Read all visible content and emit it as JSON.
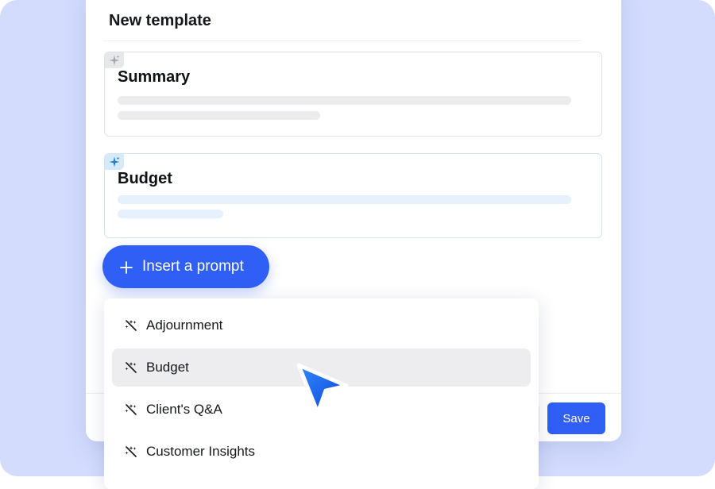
{
  "template": {
    "title": "New template",
    "blocks": [
      {
        "title": "Summary",
        "icon": "sparkle-icon",
        "state": "inactive"
      },
      {
        "title": "Budget",
        "icon": "sparkle-icon",
        "state": "active"
      }
    ]
  },
  "insert_button": {
    "label": "Insert a prompt",
    "icon": "plus-icon"
  },
  "footer": {
    "save_label": "Save"
  },
  "prompt_menu": {
    "selected_index": 1,
    "items": [
      {
        "label": "Adjournment",
        "icon": "magic-wand-icon"
      },
      {
        "label": "Budget",
        "icon": "magic-wand-icon"
      },
      {
        "label": "Client's Q&A",
        "icon": "magic-wand-icon"
      },
      {
        "label": "Customer Insights",
        "icon": "magic-wand-icon"
      }
    ]
  },
  "colors": {
    "accent": "#2f5ff5",
    "backdrop": "#d3dcfd",
    "selected_row": "#ededef",
    "active_block_border": "#cfe3f7",
    "cursor": "#1d63e8"
  }
}
